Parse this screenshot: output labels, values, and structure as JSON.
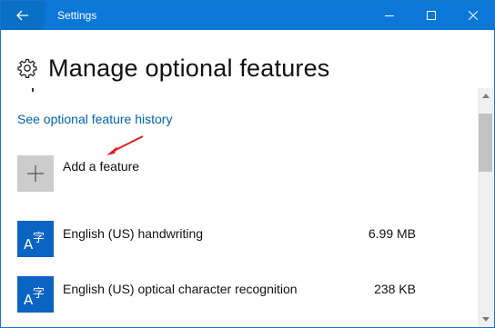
{
  "window": {
    "title": "Settings"
  },
  "page": {
    "title": "Manage optional features",
    "history_link": "See optional feature history"
  },
  "add_feature": {
    "label": "Add a feature"
  },
  "features": [
    {
      "name": "English (US) handwriting",
      "size": "6.99 MB",
      "icon": "language-icon"
    },
    {
      "name": "English (US) optical character recognition",
      "size": "238 KB",
      "icon": "language-icon"
    }
  ],
  "colors": {
    "titlebar": "#0b78d7",
    "link": "#0063b1",
    "feature_icon": "#0b63c4",
    "annotation_arrow": "#e02020"
  }
}
